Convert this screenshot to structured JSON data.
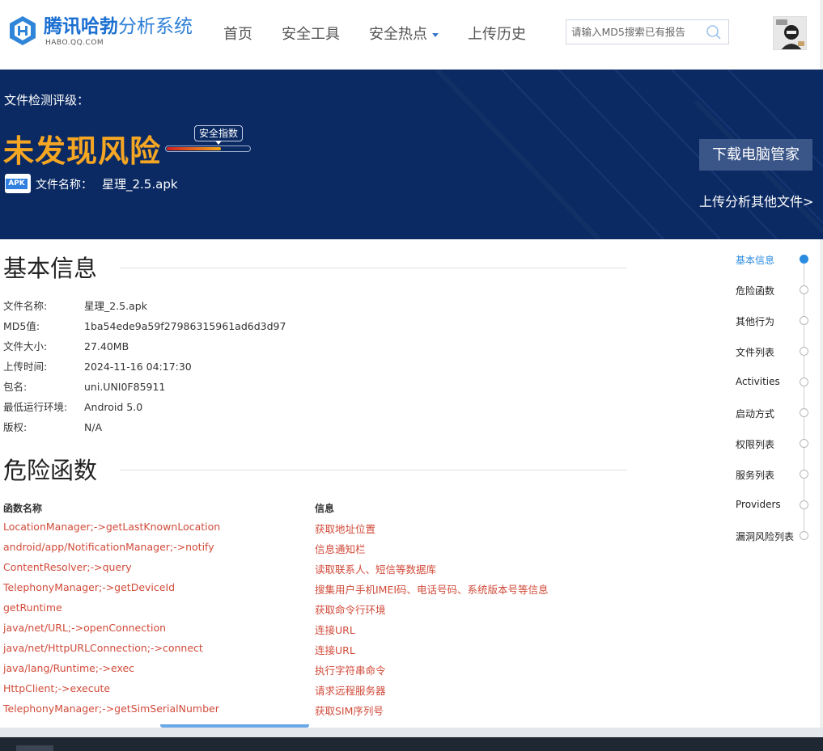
{
  "header": {
    "logo_brand": "腾讯哈勃",
    "logo_rest": "分析系统",
    "logo_sub": "HABO.QQ.COM",
    "nav": [
      {
        "label": "首页"
      },
      {
        "label": "安全工具"
      },
      {
        "label": "安全热点",
        "dropdown": true
      },
      {
        "label": "上传历史"
      }
    ],
    "search_placeholder": "请输入MD5搜索已有报告"
  },
  "banner": {
    "rating_label": "文件检测评级：",
    "verdict": "未发现风险",
    "meter_label": "安全指数",
    "meter_fraction": 0.64,
    "apk_badge": "APK",
    "file_label": "文件名称：",
    "file_name": "星理_2.5.apk",
    "download_label": "下载电脑管家",
    "upload_label": "上传分析其他文件>"
  },
  "basic_info": {
    "title": "基本信息",
    "rows": [
      {
        "key": "文件名称:",
        "value": "星理_2.5.apk"
      },
      {
        "key": "MD5值:",
        "value": "1ba54ede9a59f27986315961ad6d3d97"
      },
      {
        "key": "文件大小:",
        "value": "27.40MB"
      },
      {
        "key": "上传时间:",
        "value": "2024-11-16 04:17:30"
      },
      {
        "key": "包名:",
        "value": "uni.UNI0F85911"
      },
      {
        "key": "最低运行环境:",
        "value": "Android 5.0"
      },
      {
        "key": "版权:",
        "value": "N/A"
      }
    ]
  },
  "danger": {
    "title": "危险函数",
    "col_name": "函数名称",
    "col_info": "信息",
    "rows": [
      {
        "name": "LocationManager;->getLastKnownLocation",
        "info": "获取地址位置"
      },
      {
        "name": "android/app/NotificationManager;->notify",
        "info": "信息通知栏"
      },
      {
        "name": "ContentResolver;->query",
        "info": "读取联系人、短信等数据库"
      },
      {
        "name": "TelephonyManager;->getDeviceId",
        "info": "搜集用户手机IMEI码、电话号码、系统版本号等信息"
      },
      {
        "name": "getRuntime",
        "info": "获取命令行环境"
      },
      {
        "name": "java/net/URL;->openConnection",
        "info": "连接URL"
      },
      {
        "name": "java/net/HttpURLConnection;->connect",
        "info": "连接URL"
      },
      {
        "name": "java/lang/Runtime;->exec",
        "info": "执行字符串命令"
      },
      {
        "name": "HttpClient;->execute",
        "info": "请求远程服务器"
      },
      {
        "name": "TelephonyManager;->getSimSerialNumber",
        "info": "获取SIM序列号"
      }
    ]
  },
  "side_nav": [
    {
      "label": "基本信息",
      "active": true
    },
    {
      "label": "危险函数"
    },
    {
      "label": "其他行为"
    },
    {
      "label": "文件列表"
    },
    {
      "label": "Activities"
    },
    {
      "label": "启动方式"
    },
    {
      "label": "权限列表"
    },
    {
      "label": "服务列表"
    },
    {
      "label": "Providers"
    },
    {
      "label": "漏洞风险列表"
    }
  ],
  "colors": {
    "brand_blue": "#1a6fd1",
    "banner_bg": "#0b2a63",
    "verdict_orange": "#f5a623",
    "danger_red": "#d14b3a",
    "active_blue": "#2a8be0"
  }
}
